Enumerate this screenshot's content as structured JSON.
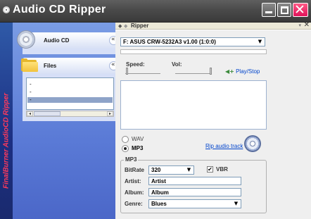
{
  "window": {
    "title": "Audio CD Ripper",
    "minimize_glyph": "",
    "close_glyph": "✕"
  },
  "left_strip": {
    "brand_text": "FinalBurner AudioCD Ripper"
  },
  "sidebar": {
    "audio_cd": {
      "label": "Audio CD",
      "collapse_glyph": "«"
    },
    "files": {
      "label": "Files",
      "collapse_glyph": "«",
      "items": [
        "-",
        "-",
        "-"
      ],
      "scroll_left": "◂",
      "scroll_right": "▸"
    }
  },
  "main": {
    "header_title": "Ripper",
    "header_back_glyph": "◆",
    "header_fwd_glyph": "◆",
    "header_pin_glyph": "▾",
    "header_close_glyph": "✕",
    "drive": {
      "value": "F: ASUS CRW-5232A3 v1.00 (1:0:0)",
      "arrow": "▼"
    },
    "speed_label": "Speed:",
    "vol_label": "Vol:",
    "play_stop_icon": "◀+",
    "play_stop": "Play/Stop",
    "format": {
      "options": [
        {
          "label": "WAV",
          "selected": false
        },
        {
          "label": "MP3",
          "selected": true
        }
      ]
    },
    "rip_link": "Rip audio track",
    "mp3": {
      "group_title": "MP3",
      "bitrate_label": "BitRate",
      "bitrate_value": "320",
      "bitrate_arrow": "▼",
      "vbr_label": "VBR",
      "vbr_checked": "✔",
      "artist_label": "Artist:",
      "artist_value": "Artist",
      "album_label": "Album:",
      "album_value": "Album",
      "genre_label": "Genre:",
      "genre_value": "Blues",
      "genre_arrow": "▼"
    }
  }
}
